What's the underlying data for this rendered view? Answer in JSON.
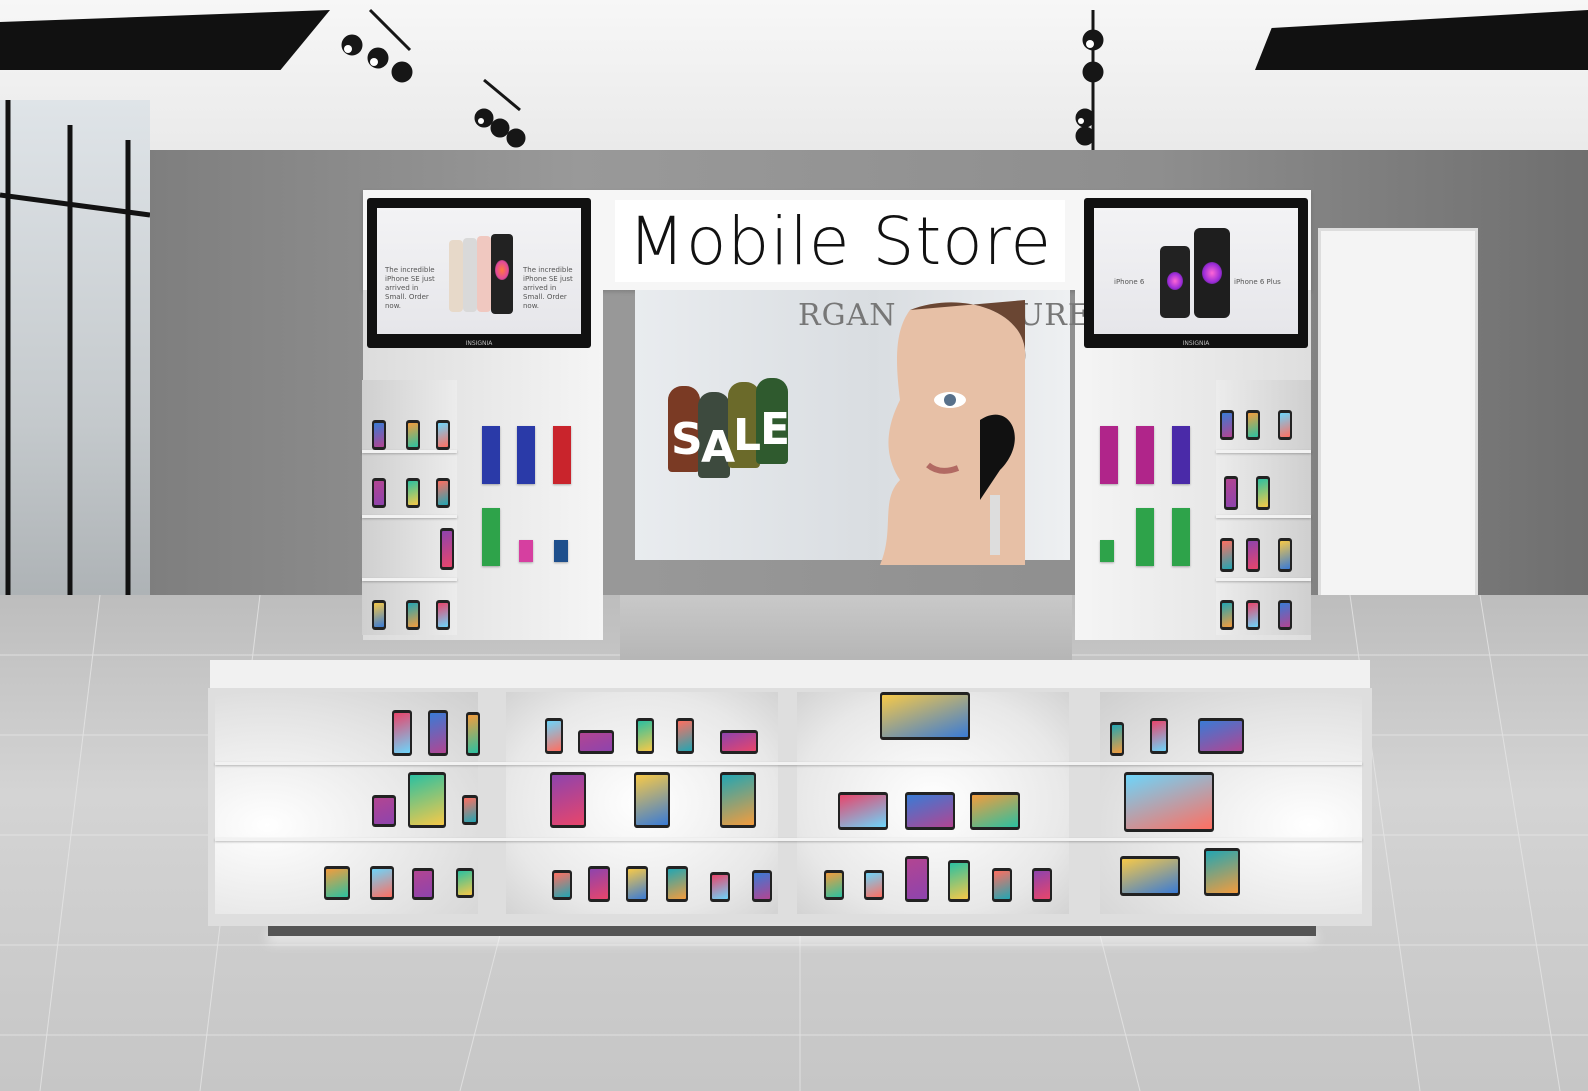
{
  "store": {
    "sign_text": "Mobile Store",
    "sale_letters": [
      "S",
      "A",
      "L",
      "E"
    ],
    "poster_text_left": "RGAN",
    "poster_text_right": "URE"
  },
  "left_tv": {
    "brand": "INSIGNIA",
    "caption_left": "The incredible iPhone SE just arrived in Small. Order now.",
    "caption_right": "The incredible iPhone SE just arrived in Small. Order now."
  },
  "right_tv": {
    "brand": "INSIGNIA",
    "label_left": "iPhone 6",
    "label_right": "iPhone 6 Plus"
  },
  "colors": {
    "wall": "#8a8a8a",
    "ceiling": "#f1f1f1",
    "floor": "#c9c9c9",
    "kiosk_white": "#f4f4f4",
    "sign_bg": "#ffffff",
    "tag_colors": [
      "#7a3a24",
      "#3d4a3e",
      "#6b6a2a",
      "#2f5a2e"
    ]
  }
}
